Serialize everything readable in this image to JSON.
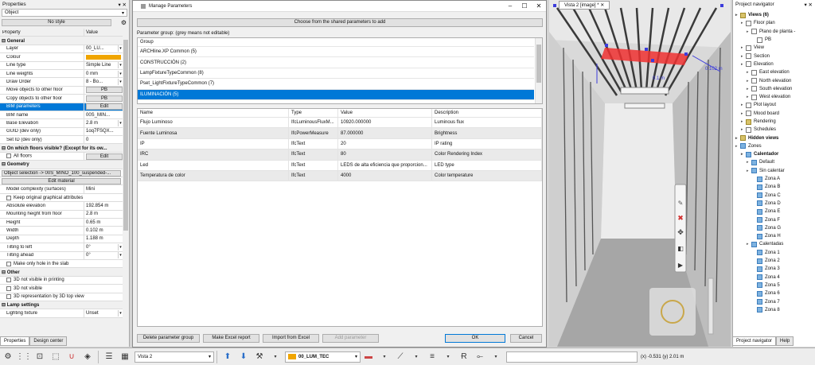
{
  "properties": {
    "title": "Properties",
    "object_combo": "Object",
    "style_button": "No style",
    "header": {
      "name": "Property",
      "value": "Value"
    },
    "sections": {
      "general": "General",
      "floors": "On which floors visible? (Except for its ow...",
      "geometry": "Geometry",
      "other": "Other",
      "lamp": "Lamp settings"
    },
    "general_rows": [
      {
        "name": "Layer",
        "value": "00_LU..."
      },
      {
        "name": "Colour",
        "value": ""
      },
      {
        "name": "Line type",
        "value": "Simple Line"
      },
      {
        "name": "Line weights",
        "value": "0 mm"
      },
      {
        "name": "Draw Order",
        "value": "8 - Bo..."
      },
      {
        "name": "Move objects to other floor",
        "value": "PB"
      },
      {
        "name": "Copy objects to other floor",
        "value": "PB"
      },
      {
        "name": "BIM parameters",
        "value": "Edit"
      },
      {
        "name": "BIM name",
        "value": "00S_MIN..."
      },
      {
        "name": "Base Elevation",
        "value": "2.8 m"
      },
      {
        "name": "GUID (dev only)",
        "value": "1oq7FSQX..."
      },
      {
        "name": "Set ID (dev only)",
        "value": "0"
      }
    ],
    "all_floors": {
      "name": "All floors",
      "value": "Edit"
    },
    "object_selection": "Object selection -> 00S_MINO_100_suspended-...",
    "edit_material": "Edit material",
    "geometry_rows": [
      {
        "name": "Model complexity (surfaces)",
        "value": "Mini"
      },
      {
        "name": "Keep original graphical attributes",
        "value": ""
      },
      {
        "name": "Absolute elevation",
        "value": "192.854 m"
      },
      {
        "name": "Mounting height from floor",
        "value": "2.8 m"
      },
      {
        "name": "Height",
        "value": "0.65 m"
      },
      {
        "name": "Width",
        "value": "0.102 m"
      },
      {
        "name": "Depth",
        "value": "1.188 m"
      },
      {
        "name": "Tilting to left",
        "value": "0°"
      },
      {
        "name": "Tilting ahead",
        "value": "0°"
      },
      {
        "name": "Make only hole in the slab",
        "value": ""
      }
    ],
    "other_rows": [
      "3D not visible in printing",
      "3D not visible",
      "3D representation by 3D top view"
    ],
    "lamp_rows": [
      {
        "name": "Lighting fixture",
        "value": "Unset"
      }
    ],
    "tabs": [
      "Properties",
      "Design center"
    ]
  },
  "dialog": {
    "title": "Manage Parameters",
    "shared_button": "Choose from the shared parameters to add",
    "group_label": "Parameter group: (grey means not editable)",
    "group_header": "Group",
    "groups": [
      "ARCHline.XP Common (5)",
      "CONSTRUCCIÓN (2)",
      "LampFixtureTypeCommon (8)",
      "Pset_LightFixtureTypeCommon (7)",
      "ILUMINACIÓN (5)"
    ],
    "param_headers": [
      "Name",
      "Type",
      "Value",
      "Description"
    ],
    "params": [
      [
        "Flujo Luminoso",
        "IfcLuminousFluxM...",
        "10920.000000",
        "Luminous flux"
      ],
      [
        "Fuente Luminosa",
        "IfcPowerMeasure",
        "87.000000",
        "Brightness"
      ],
      [
        "IP",
        "IfcText",
        "20",
        "IP rating"
      ],
      [
        "IRC",
        "IfcText",
        "80",
        "Color Rendering Index"
      ],
      [
        "Led",
        "IfcText",
        "LEDS de alta eficiencia que proporcion...",
        "LED type"
      ],
      [
        "Temperatura de color",
        "IfcText",
        "4000",
        "Color temperature"
      ]
    ],
    "buttons": {
      "delete_group": "Delete parameter group",
      "excel_report": "Make Excel report",
      "import_excel": "Import from Excel",
      "add_param": "Add parameter",
      "ok": "OK",
      "cancel": "Cancel"
    }
  },
  "viewport": {
    "tab": "Vista 2 [image] *",
    "dim1": "0.1 m",
    "dim2": "0.102 m"
  },
  "navigator": {
    "title": "Project navigator",
    "rows": [
      {
        "label": "Views (6)",
        "level": 0,
        "bold": true
      },
      {
        "label": "Floor plan",
        "level": 1
      },
      {
        "label": "Plano de planta -",
        "level": 2
      },
      {
        "label": "PB",
        "level": 3
      },
      {
        "label": "View",
        "level": 1
      },
      {
        "label": "Section",
        "level": 1
      },
      {
        "label": "Elevation",
        "level": 1
      },
      {
        "label": "East elevation",
        "level": 2
      },
      {
        "label": "North elevation",
        "level": 2
      },
      {
        "label": "South elevation",
        "level": 2
      },
      {
        "label": "West elevation",
        "level": 2
      },
      {
        "label": "Plot layout",
        "level": 1
      },
      {
        "label": "Mood board",
        "level": 1
      },
      {
        "label": "Rendering",
        "level": 1
      },
      {
        "label": "Schedules",
        "level": 1
      },
      {
        "label": "Hidden views",
        "level": 0,
        "bold": true
      },
      {
        "label": "Zones",
        "level": 0
      },
      {
        "label": "Calentador",
        "level": 1,
        "bold": true
      },
      {
        "label": "Default",
        "level": 2
      },
      {
        "label": "Sin calentar",
        "level": 2
      },
      {
        "label": "Zona A",
        "level": 3
      },
      {
        "label": "Zona B",
        "level": 3
      },
      {
        "label": "Zona C",
        "level": 3
      },
      {
        "label": "Zona D",
        "level": 3
      },
      {
        "label": "Zona E",
        "level": 3
      },
      {
        "label": "Zona F",
        "level": 3
      },
      {
        "label": "Zona G",
        "level": 3
      },
      {
        "label": "Zona H",
        "level": 3
      },
      {
        "label": "Calentadas",
        "level": 2
      },
      {
        "label": "Zona 1",
        "level": 3
      },
      {
        "label": "Zona 2",
        "level": 3
      },
      {
        "label": "Zona 3",
        "level": 3
      },
      {
        "label": "Zona 4",
        "level": 3
      },
      {
        "label": "Zona 5",
        "level": 3
      },
      {
        "label": "Zona 6",
        "level": 3
      },
      {
        "label": "Zona 7",
        "level": 3
      },
      {
        "label": "Zona 8",
        "level": 3
      }
    ],
    "tabs": [
      "Project navigator",
      "Help"
    ]
  },
  "toolbar": {
    "view_combo": "Vista 2",
    "layer_combo": "00_LUM_TEC",
    "coords": "(x) -0.531  (y) 2.01 m"
  }
}
